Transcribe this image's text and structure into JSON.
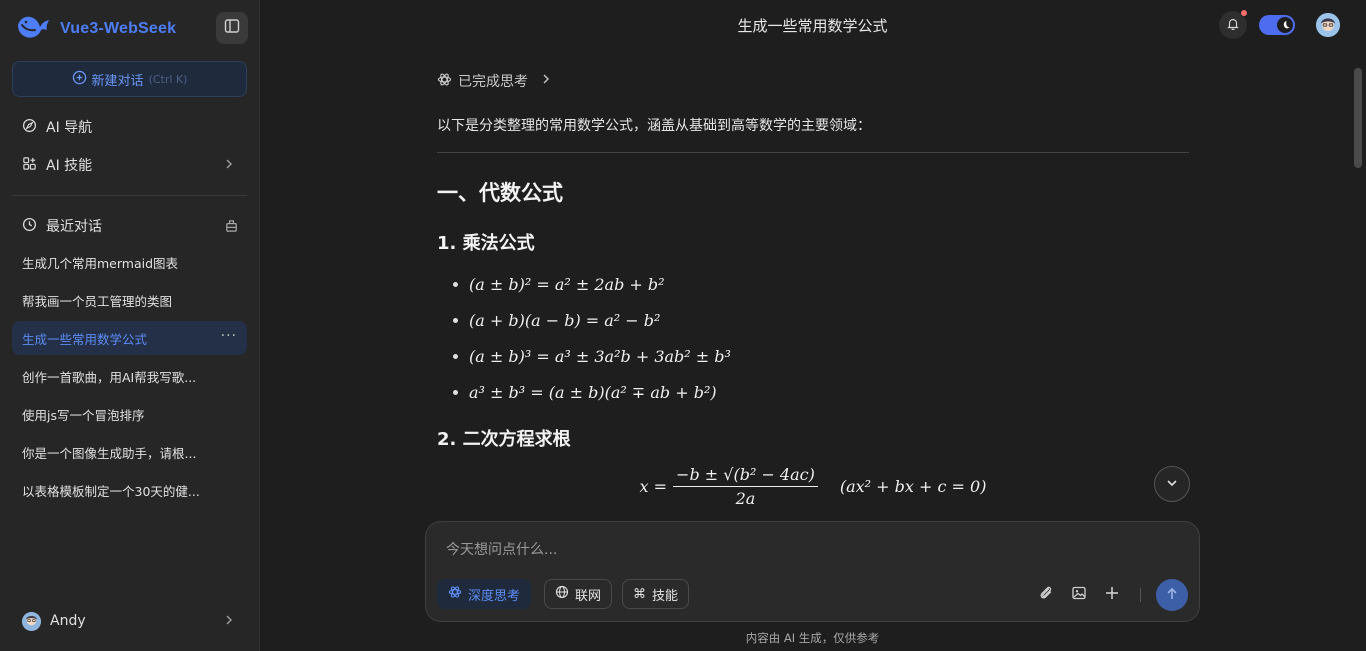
{
  "brand": {
    "name": "Vue3-WebSeek",
    "accent": "#4d7df7"
  },
  "sidebar": {
    "new_chat_label": "新建对话",
    "new_chat_shortcut": "(Ctrl K)",
    "nav": [
      {
        "label": "AI 导航",
        "icon": "compass-icon"
      },
      {
        "label": "AI 技能",
        "icon": "apps-icon"
      }
    ],
    "recent_label": "最近对话",
    "conversations": [
      {
        "title": "生成几个常用mermaid图表",
        "active": false
      },
      {
        "title": "帮我画一个员工管理的类图",
        "active": false
      },
      {
        "title": "生成一些常用数学公式",
        "active": true
      },
      {
        "title": "创作一首歌曲，用AI帮我写歌...",
        "active": false
      },
      {
        "title": "使用js写一个冒泡排序",
        "active": false
      },
      {
        "title": "你是一个图像生成助手，请根...",
        "active": false
      },
      {
        "title": "以表格模板制定一个30天的健...",
        "active": false
      }
    ],
    "user_name": "Andy"
  },
  "header": {
    "title": "生成一些常用数学公式"
  },
  "message": {
    "think_label": "已完成思考",
    "intro": "以下是分类整理的常用数学公式，涵盖从基础到高等数学的主要领域：",
    "section1_title": "一、代数公式",
    "sub1_title": "1. 乘法公式",
    "formulas": [
      "(a ± b)² = a² ± 2ab + b²",
      "(a + b)(a − b) = a² − b²",
      "(a ± b)³ = a³ ± 3a²b + 3ab² ± b³",
      "a³ ± b³ = (a ± b)(a² ∓ ab + b²)"
    ],
    "sub2_title": "2. 二次方程求根",
    "quadratic": {
      "lhs": "x =",
      "numerator": "−b ± √(b² − 4ac)",
      "denominator": "2a",
      "condition": "(ax² + bx + c = 0)"
    }
  },
  "composer": {
    "placeholder": "今天想问点什么...",
    "chips": [
      {
        "label": "深度思考",
        "active": true
      },
      {
        "label": "联网",
        "active": false
      },
      {
        "label": "技能",
        "active": false
      }
    ]
  },
  "footer_note": "内容由 AI 生成，仅供参考"
}
